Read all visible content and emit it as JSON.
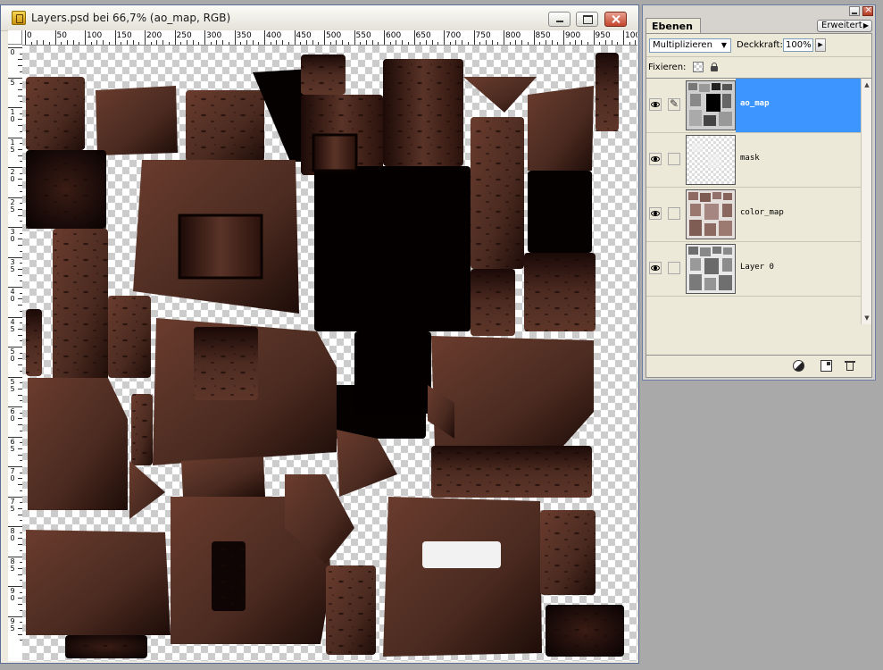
{
  "document_window": {
    "title": "Layers.psd bei 66,7% (ao_map, RGB)"
  },
  "rulers": {
    "horizontal_labels": [
      "0",
      "50",
      "100",
      "150",
      "200",
      "250",
      "300",
      "350",
      "400",
      "450",
      "500",
      "550",
      "600",
      "650",
      "700",
      "750",
      "800",
      "850",
      "900",
      "950",
      "100"
    ],
    "vertical_labels": [
      "0",
      "5",
      "1 0",
      "1 5",
      "2 0",
      "2 5",
      "3 0",
      "3 5",
      "4 0",
      "4 5",
      "5 0",
      "5 5",
      "6 0",
      "6 5",
      "7 0",
      "7 5",
      "8 0",
      "8 5",
      "9 0",
      "9 5"
    ]
  },
  "layers_panel": {
    "tab_label": "Ebenen",
    "menu_button_label": "Erweitert",
    "blend_mode": "Multiplizieren",
    "opacity_label": "Deckkraft:",
    "opacity_value": "100%",
    "lock_label": "Fixieren:",
    "layers": [
      {
        "name": "ao_map",
        "selected": true,
        "visible": true,
        "thumb": "ao"
      },
      {
        "name": "mask",
        "selected": false,
        "visible": true,
        "thumb": "mask"
      },
      {
        "name": "color_map",
        "selected": false,
        "visible": true,
        "thumb": "color"
      },
      {
        "name": "Layer 0",
        "selected": false,
        "visible": true,
        "thumb": "layer0"
      }
    ]
  },
  "colors": {
    "selection": "#3d95ff",
    "texture_brown": "#4a2a20",
    "texture_dark": "#120605"
  }
}
